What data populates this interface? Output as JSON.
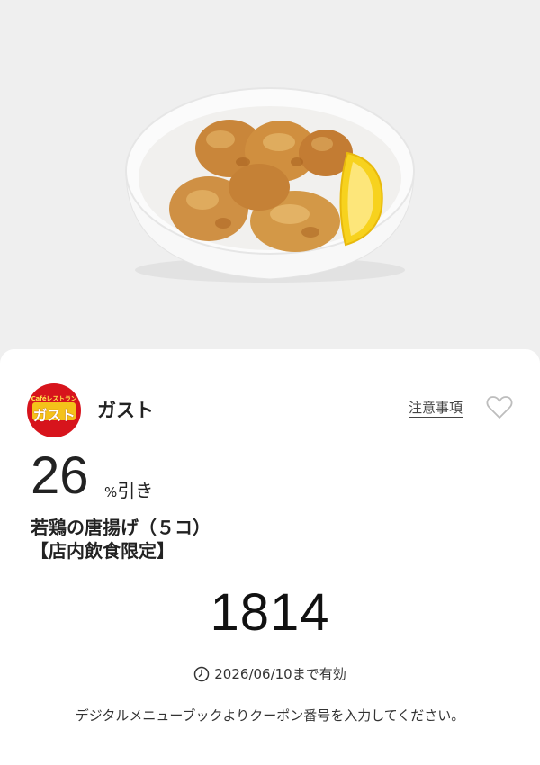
{
  "hero": {
    "image_subject": "karaage-fried-chicken-bowl"
  },
  "brand": {
    "logo_top_text": "Caféレストラン",
    "logo_main_text": "ガスト",
    "name": "ガスト",
    "logo_color": "#d7141c",
    "logo_accent_color": "#f4c21a"
  },
  "header": {
    "notes_link": "注意事項",
    "favorite_icon": "heart-outline-icon"
  },
  "discount": {
    "value": "26",
    "percent_symbol": "%",
    "suffix": "引き"
  },
  "item": {
    "name": "若鶏の唐揚げ（５コ）",
    "note": "【店内飲食限定】"
  },
  "coupon": {
    "code": "1814"
  },
  "validity": {
    "icon": "clock-icon",
    "text": "2026/06/10まで有効"
  },
  "instruction": "デジタルメニューブックよりクーポン番号を入力してください。"
}
